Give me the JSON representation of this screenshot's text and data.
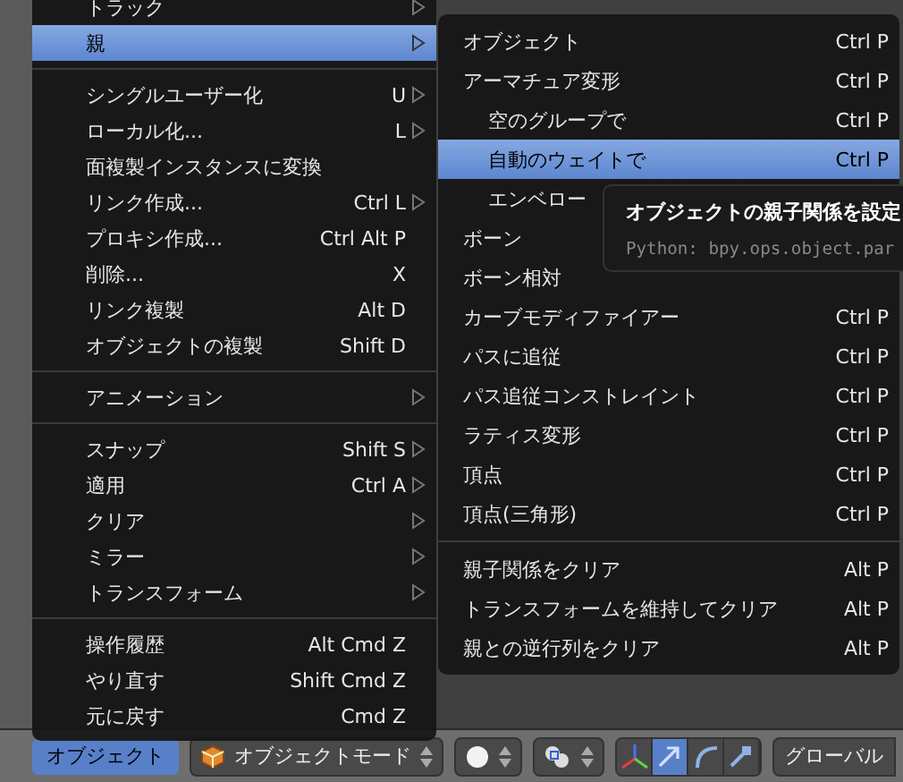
{
  "object_menu": {
    "items": [
      {
        "kind": "item",
        "label": "トラック",
        "submenu": true,
        "selected": false
      },
      {
        "kind": "item",
        "label": "親",
        "submenu": true,
        "selected": true
      },
      {
        "kind": "separator"
      },
      {
        "kind": "item",
        "label": "シングルユーザー化",
        "shortcut": "U",
        "submenu": true,
        "selected": false
      },
      {
        "kind": "item",
        "label": "ローカル化...",
        "shortcut": "L",
        "submenu": true,
        "selected": false
      },
      {
        "kind": "item",
        "label": "面複製インスタンスに変換",
        "submenu": false,
        "selected": false
      },
      {
        "kind": "item",
        "label": "リンク作成...",
        "shortcut": "Ctrl L",
        "submenu": true,
        "selected": false
      },
      {
        "kind": "item",
        "label": "プロキシ作成...",
        "shortcut": "Ctrl Alt P",
        "submenu": false,
        "selected": false
      },
      {
        "kind": "item",
        "label": "削除...",
        "shortcut": "X",
        "submenu": false,
        "selected": false
      },
      {
        "kind": "item",
        "label": "リンク複製",
        "shortcut": "Alt D",
        "submenu": false,
        "selected": false
      },
      {
        "kind": "item",
        "label": "オブジェクトの複製",
        "shortcut": "Shift D",
        "submenu": false,
        "selected": false
      },
      {
        "kind": "separator"
      },
      {
        "kind": "item",
        "label": "アニメーション",
        "submenu": true,
        "selected": false
      },
      {
        "kind": "separator"
      },
      {
        "kind": "item",
        "label": "スナップ",
        "shortcut": "Shift S",
        "submenu": true,
        "selected": false
      },
      {
        "kind": "item",
        "label": "適用",
        "shortcut": "Ctrl A",
        "submenu": true,
        "selected": false
      },
      {
        "kind": "item",
        "label": "クリア",
        "submenu": true,
        "selected": false
      },
      {
        "kind": "item",
        "label": "ミラー",
        "submenu": true,
        "selected": false
      },
      {
        "kind": "item",
        "label": "トランスフォーム",
        "submenu": true,
        "selected": false
      },
      {
        "kind": "separator"
      },
      {
        "kind": "item",
        "label": "操作履歴",
        "shortcut": "Alt Cmd Z",
        "submenu": false,
        "selected": false
      },
      {
        "kind": "item",
        "label": "やり直す",
        "shortcut": "Shift Cmd Z",
        "submenu": false,
        "selected": false
      },
      {
        "kind": "item",
        "label": "元に戻す",
        "shortcut": "Cmd Z",
        "submenu": false,
        "selected": false
      }
    ]
  },
  "parent_submenu": {
    "items": [
      {
        "kind": "item",
        "label": "オブジェクト",
        "shortcut": "Ctrl P",
        "selected": false
      },
      {
        "kind": "item",
        "label": "アーマチュア変形",
        "shortcut": "Ctrl P",
        "selected": false,
        "children": [
          {
            "kind": "item",
            "label": "空のグループで",
            "shortcut": "Ctrl P",
            "selected": false
          },
          {
            "kind": "item",
            "label": "自動のウェイトで",
            "shortcut": "Ctrl P",
            "selected": true
          },
          {
            "kind": "item",
            "label": "エンベロー",
            "selected": false
          }
        ]
      },
      {
        "kind": "item",
        "label": "ボーン",
        "selected": false
      },
      {
        "kind": "item",
        "label": "ボーン相対",
        "selected": false
      },
      {
        "kind": "item",
        "label": "カーブモディファイアー",
        "shortcut": "Ctrl P",
        "selected": false
      },
      {
        "kind": "item",
        "label": "パスに追従",
        "shortcut": "Ctrl P",
        "selected": false
      },
      {
        "kind": "item",
        "label": "パス追従コンストレイント",
        "shortcut": "Ctrl P",
        "selected": false
      },
      {
        "kind": "item",
        "label": "ラティス変形",
        "shortcut": "Ctrl P",
        "selected": false
      },
      {
        "kind": "item",
        "label": "頂点",
        "shortcut": "Ctrl P",
        "selected": false
      },
      {
        "kind": "item",
        "label": "頂点(三角形)",
        "shortcut": "Ctrl P",
        "selected": false
      },
      {
        "kind": "separator"
      },
      {
        "kind": "item",
        "label": "親子関係をクリア",
        "shortcut": "Alt P",
        "selected": false
      },
      {
        "kind": "item",
        "label": "トランスフォームを維持してクリア",
        "shortcut": "Alt P",
        "selected": false
      },
      {
        "kind": "item",
        "label": "親との逆行列をクリア",
        "shortcut": "Alt P",
        "selected": false
      }
    ]
  },
  "tooltip": {
    "title": "オブジェクトの親子関係を設定",
    "python": "Python: bpy.ops.object.par"
  },
  "header": {
    "menu_button": {
      "label": "オブジェクト",
      "active": true
    },
    "mode_dropdown": {
      "label": "オブジェクトモード"
    },
    "manipulators": [
      {
        "kind": "axes",
        "selected": false
      },
      {
        "kind": "translate",
        "selected": true
      },
      {
        "kind": "rotate",
        "selected": false
      },
      {
        "kind": "scale",
        "selected": false
      }
    ],
    "orientation": {
      "label": "グローバル"
    }
  }
}
